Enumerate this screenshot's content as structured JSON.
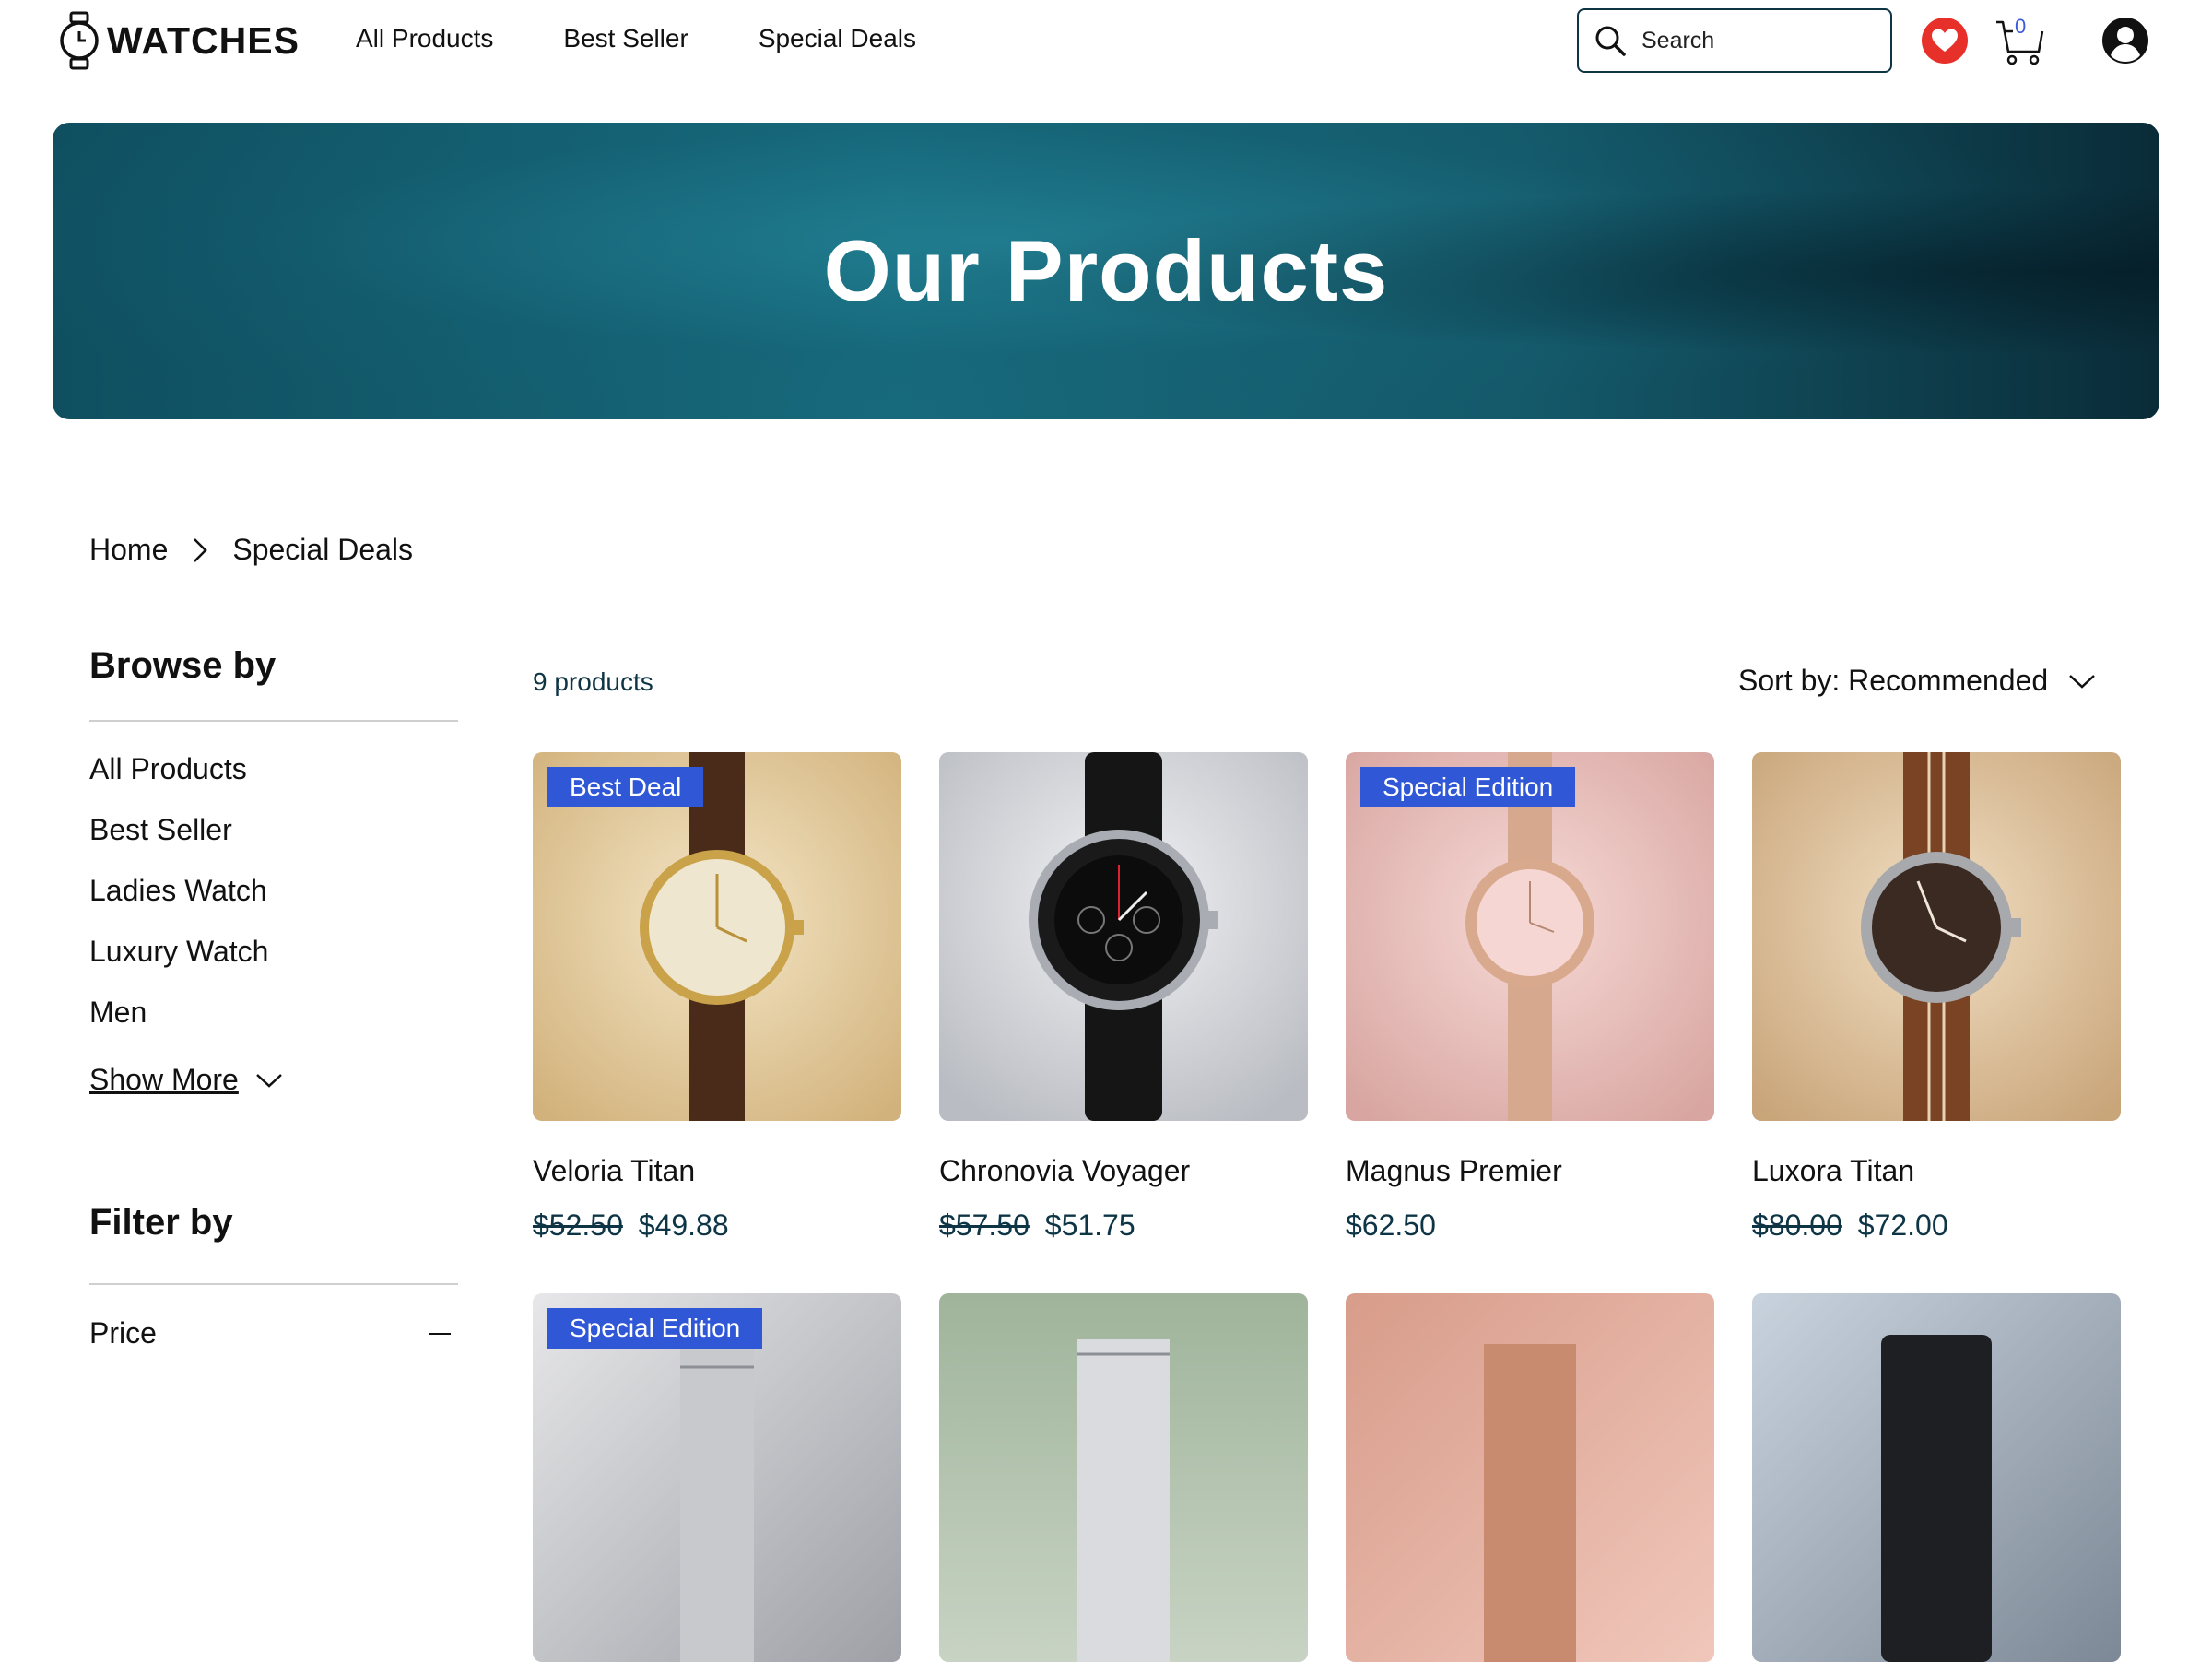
{
  "header": {
    "logo_text": "WATCHES",
    "nav": [
      "All Products",
      "Best Seller",
      "Special Deals"
    ],
    "search_placeholder": "Search",
    "cart_count": "0"
  },
  "hero": {
    "title": "Our Products"
  },
  "breadcrumb": {
    "home": "Home",
    "current": "Special Deals"
  },
  "sidebar": {
    "browse_title": "Browse by",
    "items": [
      "All Products",
      "Best Seller",
      "Ladies Watch",
      "Luxury Watch",
      "Men"
    ],
    "show_more": "Show More",
    "filter_title": "Filter by",
    "price_label": "Price"
  },
  "listing": {
    "count": "9 products",
    "sort": "Sort by: Recommended"
  },
  "products": [
    {
      "badge": "Best Deal",
      "name": "Veloria Titan",
      "old_price": "$52.50",
      "price": "$49.88"
    },
    {
      "badge": "",
      "name": "Chronovia Voyager",
      "old_price": "$57.50",
      "price": "$51.75"
    },
    {
      "badge": "Special Edition",
      "name": "Magnus Premier",
      "old_price": "",
      "price": "$62.50"
    },
    {
      "badge": "",
      "name": "Luxora Titan",
      "old_price": "$80.00",
      "price": "$72.00"
    },
    {
      "badge": "Special Edition"
    },
    {
      "badge": ""
    },
    {
      "badge": ""
    },
    {
      "badge": ""
    }
  ],
  "colors": {
    "accent": "#2f57d6",
    "brand_dark": "#0d3545",
    "wishlist": "#e8302b"
  }
}
